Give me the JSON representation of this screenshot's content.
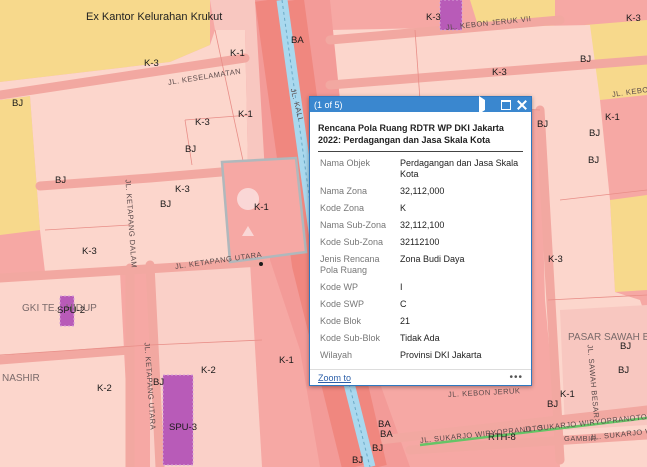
{
  "map": {
    "place_labels": [
      {
        "id": "ex-kantor",
        "text": "Ex Kantor Kelurahan Krukut"
      },
      {
        "id": "gki",
        "text": "GKI TE... HIDUP"
      },
      {
        "id": "nashir",
        "text": "NASHIR"
      },
      {
        "id": "pasar",
        "text": "PASAR SAWAH B"
      }
    ],
    "zone_labels": [
      {
        "id": "z1",
        "text": "K-3"
      },
      {
        "id": "z2",
        "text": "K-1"
      },
      {
        "id": "z3",
        "text": "BA"
      },
      {
        "id": "z4",
        "text": "K-3"
      },
      {
        "id": "z5",
        "text": "K-1"
      },
      {
        "id": "z6",
        "text": "K-3"
      },
      {
        "id": "z7",
        "text": "BJ"
      },
      {
        "id": "z8",
        "text": "BJ"
      },
      {
        "id": "z9",
        "text": "K-3"
      },
      {
        "id": "z10",
        "text": "K-1"
      },
      {
        "id": "z11",
        "text": "BJ"
      },
      {
        "id": "z12",
        "text": "K-3"
      },
      {
        "id": "z13",
        "text": "SPU-2"
      },
      {
        "id": "z14",
        "text": "K-2"
      },
      {
        "id": "z15",
        "text": "BJ"
      },
      {
        "id": "z16",
        "text": "K-2"
      },
      {
        "id": "z17",
        "text": "SPU-3"
      },
      {
        "id": "z18",
        "text": "K-1"
      },
      {
        "id": "z19",
        "text": "BA"
      },
      {
        "id": "z20",
        "text": "BA"
      },
      {
        "id": "z21",
        "text": "BJ"
      },
      {
        "id": "z22",
        "text": "BJ"
      },
      {
        "id": "z23",
        "text": "K-3"
      },
      {
        "id": "z24",
        "text": "K-3"
      },
      {
        "id": "z25",
        "text": "K-3"
      },
      {
        "id": "z26",
        "text": "BJ"
      },
      {
        "id": "z27",
        "text": "K-1"
      },
      {
        "id": "z28",
        "text": "BJ"
      },
      {
        "id": "z29",
        "text": "BJ"
      },
      {
        "id": "z30",
        "text": "RTH-8"
      },
      {
        "id": "z31",
        "text": "BJ"
      },
      {
        "id": "z32",
        "text": "BJ"
      },
      {
        "id": "z33",
        "text": "BJ"
      },
      {
        "id": "z34",
        "text": "K-1"
      },
      {
        "id": "z35",
        "text": "BJ"
      },
      {
        "id": "z36",
        "text": "BJ"
      }
    ],
    "roads": [
      {
        "id": "r1",
        "text": "JL. KESELAMATAN"
      },
      {
        "id": "r2",
        "text": "JL. KETAPANG UTARA"
      },
      {
        "id": "r3",
        "text": "JL. KETAPANG DALAM"
      },
      {
        "id": "r4",
        "text": "JL. KETAPANG UTARA"
      },
      {
        "id": "r5",
        "text": "JL. KEBON JERUK VII"
      },
      {
        "id": "r6",
        "text": "JL. KEBON"
      },
      {
        "id": "r7",
        "text": "JL. SUKARJO WIRYOPRANOTO"
      },
      {
        "id": "r8",
        "text": "JL. SUKARJO WIRYOPRANOTO"
      },
      {
        "id": "r9",
        "text": "JL. SUKARJO WIRYOPRANOTO"
      },
      {
        "id": "r10",
        "text": "JL. KEBON JERUK"
      },
      {
        "id": "r11",
        "text": "JL. SAWAH BESAR"
      },
      {
        "id": "r12",
        "text": "JL. KALI"
      },
      {
        "id": "r13",
        "text": "GAMBIR"
      }
    ],
    "colors": {
      "commercial": "#f6a8a4",
      "commercial_dark": "#f39b98",
      "residential": "#fcd6cc",
      "yellow": "#f7d98c",
      "road": "#f2a8a1",
      "railway": "#a9d8ee",
      "highlight": "#b0b8bc",
      "spu": "#b85bb8",
      "green": "#66c466",
      "popup_header": "#3a87cf"
    }
  },
  "popup": {
    "counter": "(1 of 5)",
    "title": "Rencana Pola Ruang RDTR WP DKI Jakarta 2022: Perdagangan dan Jasa Skala Kota",
    "fields": [
      {
        "key": "Nama Objek",
        "value": "Perdagangan dan Jasa Skala Kota"
      },
      {
        "key": "Nama Zona",
        "value": "32,112,000"
      },
      {
        "key": "Kode Zona",
        "value": "K"
      },
      {
        "key": "Nama Sub-Zona",
        "value": "32,112,100"
      },
      {
        "key": "Kode Sub-Zona",
        "value": "32112100"
      },
      {
        "key": "Jenis Rencana Pola Ruang",
        "value": "Zona Budi Daya"
      },
      {
        "key": "Kode WP",
        "value": "I"
      },
      {
        "key": "Kode SWP",
        "value": "C"
      },
      {
        "key": "Kode Blok",
        "value": "21"
      },
      {
        "key": "Kode Sub-Blok",
        "value": "Tidak Ada"
      },
      {
        "key": "Wilayah Administrasi",
        "value": "Provinsi DKI Jakarta"
      }
    ],
    "zoom_label": "Zoom to",
    "more_label": "•••",
    "icons": {
      "next": "play-icon",
      "maximize": "maximize-icon",
      "close": "close-icon"
    }
  }
}
